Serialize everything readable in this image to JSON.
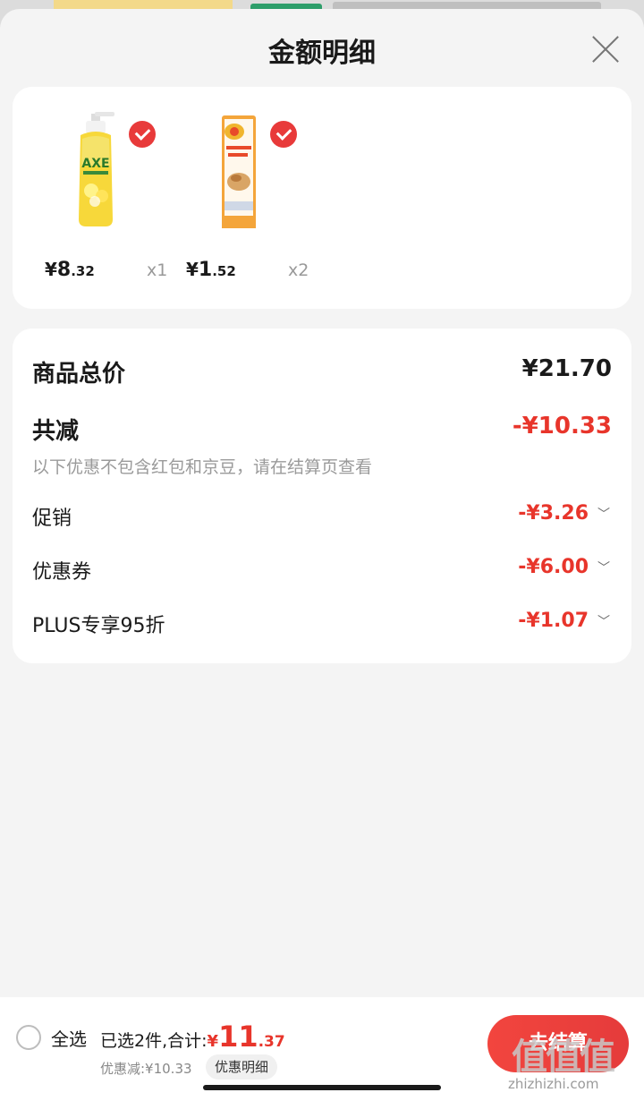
{
  "sheet": {
    "title": "金额明细"
  },
  "products": [
    {
      "name_icon": "axe-dish-soap-bottle",
      "price_yen": "¥",
      "price_int": "8",
      "price_dec": ".32",
      "qty": "x1",
      "selected": true
    },
    {
      "name_icon": "oat-snack-pack",
      "price_yen": "¥",
      "price_int": "1",
      "price_dec": ".52",
      "qty": "x2",
      "selected": true
    }
  ],
  "detail": {
    "total_label": "商品总价",
    "total_value": "¥21.70",
    "reduce_label": "共减",
    "reduce_value": "-¥10.33",
    "reduce_note": "以下优惠不包含红包和京豆，请在结算页查看",
    "promo_label": "促销",
    "promo_value": "-¥3.26",
    "coupon_label": "优惠券",
    "coupon_value": "-¥6.00",
    "plus_label": "PLUS专享95折",
    "plus_value": "-¥1.07",
    "chevron": "﹀"
  },
  "bottom": {
    "select_all": "全选",
    "selected_text": "已选2件,合计:",
    "total_yen": "¥",
    "total_int": "11",
    "total_dec": ".37",
    "discount_text": "优惠减:¥10.33",
    "discount_detail_btn": "优惠明细",
    "checkout_btn": "去结算"
  },
  "watermark": {
    "logo": "值值值",
    "url": "zhizhizhi.com"
  },
  "colors": {
    "accent": "#e8352b",
    "check": "#e83a3a",
    "background": "#f4f4f4"
  }
}
